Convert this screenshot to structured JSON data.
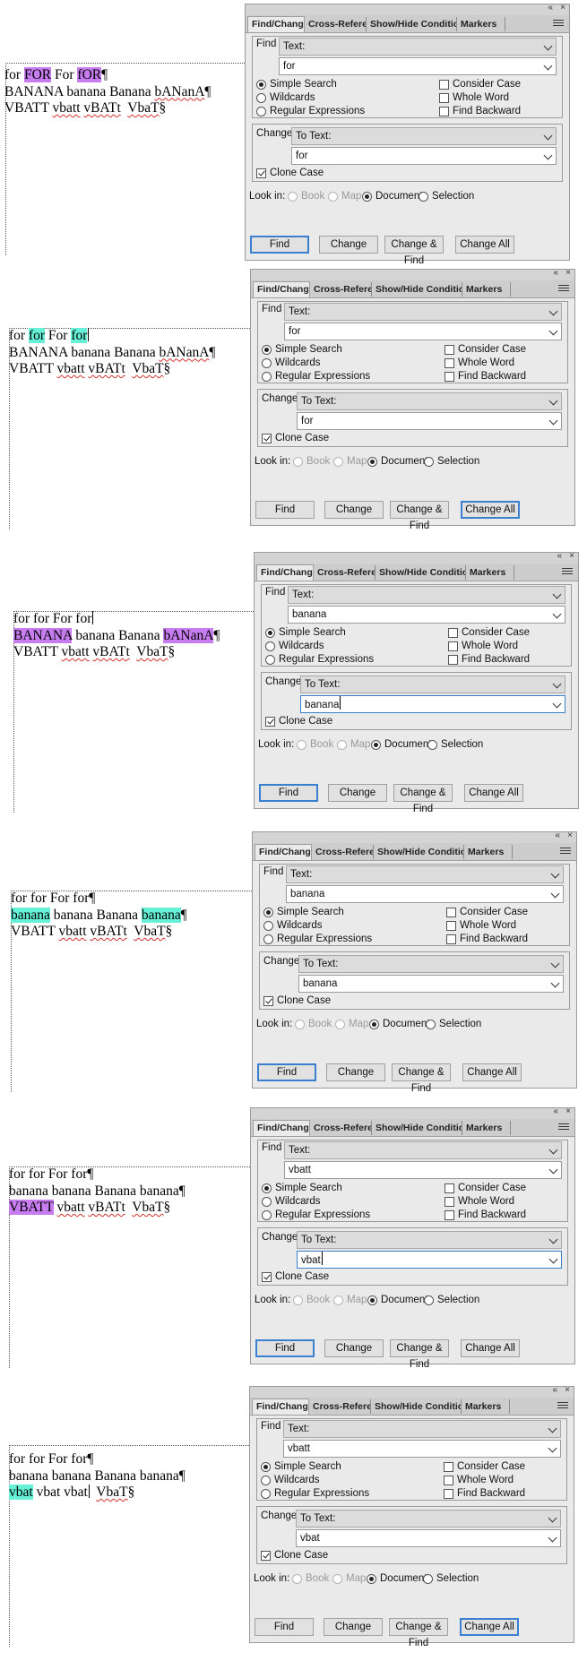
{
  "tabs": [
    "Find/Change",
    "Cross-Reference",
    "Show/Hide Conditiona",
    "Markers"
  ],
  "window_controls": {
    "collapse": "«",
    "close": "×"
  },
  "labels": {
    "find": "Find",
    "change": "Change",
    "find_type": "Text:",
    "change_type": "To Text:",
    "simple_search": "Simple Search",
    "wildcards": "Wildcards",
    "regular_expressions": "Regular Expressions",
    "consider_case": "Consider Case",
    "whole_word": "Whole Word",
    "find_backward": "Find Backward",
    "clone_case": "Clone Case",
    "look_in": "Look in:",
    "book": "Book",
    "map": "Map",
    "document": "Document",
    "selection": "Selection"
  },
  "buttons": {
    "find": "Find",
    "change": "Change",
    "change_find": "Change & Find",
    "change_all": "Change All"
  },
  "steps": [
    {
      "find_value": "for",
      "change_value": "for",
      "change_focused": false,
      "default_button": "find",
      "doc": [
        [
          {
            "t": "for",
            "hl": ""
          },
          {
            "t": " ",
            "hl": ""
          },
          {
            "t": "FOR",
            "hl": "p"
          },
          {
            "t": " For ",
            "hl": ""
          },
          {
            "t": "fOR",
            "hl": "p"
          },
          {
            "t": "¶",
            "hl": ""
          }
        ],
        [
          {
            "t": "BANANA banana Banana ",
            "hl": ""
          },
          {
            "t": "bANanA",
            "hl": "",
            "sq": true
          },
          {
            "t": "¶",
            "hl": ""
          }
        ],
        [
          {
            "t": "VBATT ",
            "hl": ""
          },
          {
            "t": "vbatt",
            "hl": "",
            "sq": true
          },
          {
            "t": " ",
            "hl": ""
          },
          {
            "t": "vBATt",
            "hl": "",
            "sq": true
          },
          {
            "t": "  ",
            "hl": ""
          },
          {
            "t": "VbaT",
            "hl": "",
            "sq": true
          },
          {
            "t": "§",
            "hl": ""
          }
        ]
      ]
    },
    {
      "find_value": "for",
      "change_value": "for",
      "change_focused": false,
      "default_button": "change_all",
      "doc": [
        [
          {
            "t": "for",
            "hl": ""
          },
          {
            "t": " ",
            "hl": ""
          },
          {
            "t": "for",
            "hl": "t"
          },
          {
            "t": " For ",
            "hl": ""
          },
          {
            "t": "for",
            "hl": "t",
            "caret": true
          },
          {
            "t": "",
            "hl": ""
          }
        ],
        [
          {
            "t": "BANANA banana Banana ",
            "hl": ""
          },
          {
            "t": "bANanA",
            "hl": "",
            "sq": true
          },
          {
            "t": "¶",
            "hl": ""
          }
        ],
        [
          {
            "t": "VBATT ",
            "hl": ""
          },
          {
            "t": "vbatt",
            "hl": "",
            "sq": true
          },
          {
            "t": " ",
            "hl": ""
          },
          {
            "t": "vBATt",
            "hl": "",
            "sq": true
          },
          {
            "t": "  ",
            "hl": ""
          },
          {
            "t": "VbaT",
            "hl": "",
            "sq": true
          },
          {
            "t": "§",
            "hl": ""
          }
        ]
      ]
    },
    {
      "find_value": "banana",
      "change_value": "banana",
      "change_focused": true,
      "default_button": "find",
      "doc": [
        [
          {
            "t": "for for For for",
            "hl": "",
            "caret": true
          },
          {
            "t": "",
            "hl": ""
          }
        ],
        [
          {
            "t": "BANANA",
            "hl": "p"
          },
          {
            "t": " banana Banana ",
            "hl": ""
          },
          {
            "t": "bANanA",
            "hl": "p"
          },
          {
            "t": "¶",
            "hl": ""
          }
        ],
        [
          {
            "t": "VBATT ",
            "hl": ""
          },
          {
            "t": "vbatt",
            "hl": "",
            "sq": true
          },
          {
            "t": " ",
            "hl": ""
          },
          {
            "t": "vBATt",
            "hl": "",
            "sq": true
          },
          {
            "t": "  ",
            "hl": ""
          },
          {
            "t": "VbaT",
            "hl": "",
            "sq": true
          },
          {
            "t": "§",
            "hl": ""
          }
        ]
      ]
    },
    {
      "find_value": "banana",
      "change_value": "banana",
      "change_focused": false,
      "default_button": "find",
      "doc": [
        [
          {
            "t": "for for For for¶",
            "hl": ""
          }
        ],
        [
          {
            "t": "banana",
            "hl": "t"
          },
          {
            "t": " banana Banana ",
            "hl": ""
          },
          {
            "t": "banana",
            "hl": "t"
          },
          {
            "t": "¶",
            "hl": ""
          }
        ],
        [
          {
            "t": "VBATT ",
            "hl": ""
          },
          {
            "t": "vbatt",
            "hl": "",
            "sq": true
          },
          {
            "t": " ",
            "hl": ""
          },
          {
            "t": "vBATt",
            "hl": "",
            "sq": true
          },
          {
            "t": "  ",
            "hl": ""
          },
          {
            "t": "VbaT",
            "hl": "",
            "sq": true
          },
          {
            "t": "§",
            "hl": ""
          }
        ]
      ]
    },
    {
      "find_value": "vbatt",
      "change_value": "vbat",
      "change_focused": true,
      "default_button": "find",
      "doc": [
        [
          {
            "t": "for for For for¶",
            "hl": ""
          }
        ],
        [
          {
            "t": "banana banana Banana banana¶",
            "hl": ""
          }
        ],
        [
          {
            "t": "VBATT",
            "hl": "p"
          },
          {
            "t": " ",
            "hl": ""
          },
          {
            "t": "vbatt",
            "hl": "",
            "sq": true
          },
          {
            "t": " ",
            "hl": ""
          },
          {
            "t": "vBATt",
            "hl": "",
            "sq": true
          },
          {
            "t": "  ",
            "hl": ""
          },
          {
            "t": "VbaT",
            "hl": "",
            "sq": true
          },
          {
            "t": "§",
            "hl": ""
          }
        ]
      ]
    },
    {
      "find_value": "vbatt",
      "change_value": "vbat",
      "change_focused": false,
      "default_button": "change_all",
      "doc": [
        [
          {
            "t": "for for For for¶",
            "hl": ""
          }
        ],
        [
          {
            "t": "banana banana Banana banana¶",
            "hl": ""
          }
        ],
        [
          {
            "t": "vbat",
            "hl": "t"
          },
          {
            "t": " vbat vbat",
            "hl": "",
            "caret": true
          },
          {
            "t": "  ",
            "hl": ""
          },
          {
            "t": "VbaT",
            "hl": "",
            "sq": true
          },
          {
            "t": "§",
            "hl": ""
          }
        ]
      ]
    }
  ]
}
